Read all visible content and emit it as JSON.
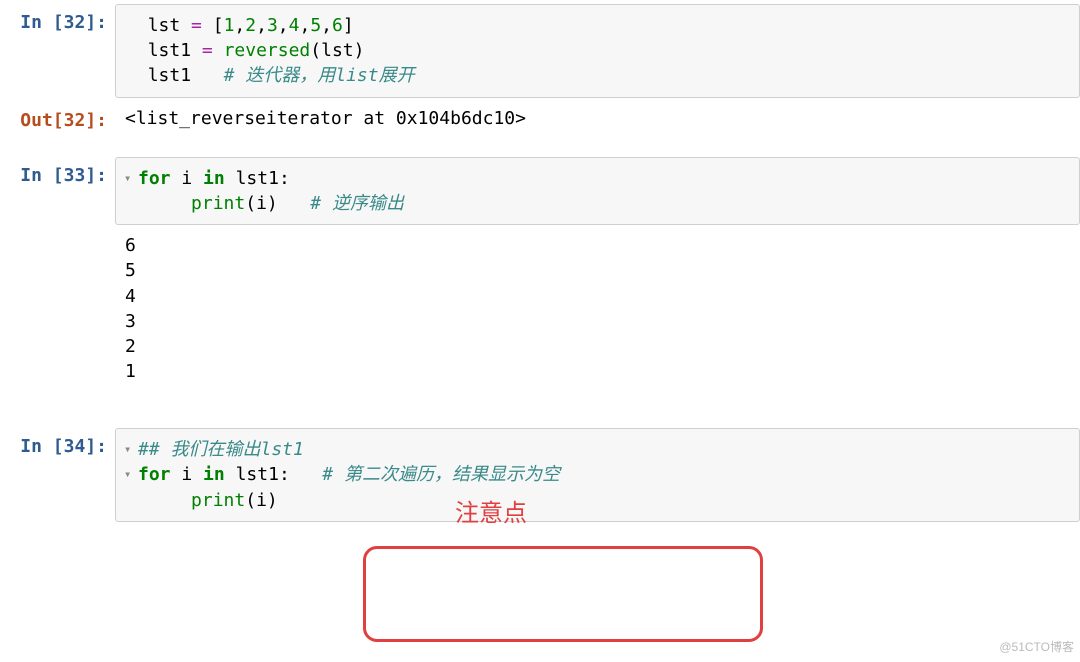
{
  "prompts": {
    "in32": "In [32]:",
    "out32": "Out[32]:",
    "in33": "In [33]:",
    "in34": "In [34]:"
  },
  "cell32": {
    "line1_var": "lst",
    "line1_eq": " = ",
    "line1_lb": "[",
    "line1_n1": "1",
    "line1_c1": ",",
    "line1_n2": "2",
    "line1_c2": ",",
    "line1_n3": "3",
    "line1_c3": ",",
    "line1_n4": "4",
    "line1_c4": ",",
    "line1_n5": "5",
    "line1_c5": ",",
    "line1_n6": "6",
    "line1_rb": "]",
    "blank": "",
    "line3_var": "lst1",
    "line3_eq": " = ",
    "line3_fn": "reversed",
    "line3_lp": "(",
    "line3_arg": "lst",
    "line3_rp": ")",
    "line4_var": "lst1",
    "line4_sp": "   ",
    "line4_cmt": "# 迭代器，用list展开"
  },
  "out32": {
    "text": "<list_reverseiterator at 0x104b6dc10>"
  },
  "cell33": {
    "expand1": "▾",
    "kw_for": "for",
    "sp1": " ",
    "var_i": "i",
    "sp2": " ",
    "kw_in": "in",
    "sp3": " ",
    "var_lst1": "lst1",
    "colon": ":",
    "indent2": "    ",
    "fn_print": "print",
    "lp": "(",
    "arg_i": "i",
    "rp": ")",
    "sp4": "   ",
    "cmt": "# 逆序输出"
  },
  "out33": {
    "l1": "6",
    "l2": "5",
    "l3": "4",
    "l4": "3",
    "l5": "2",
    "l6": "1"
  },
  "cell34": {
    "expand1": "▾",
    "cmt1": "## 我们在输出lst1",
    "blank": "",
    "expand2": "▾",
    "kw_for": "for",
    "sp1": " ",
    "var_i": "i",
    "sp2": " ",
    "kw_in": "in",
    "sp3": " ",
    "var_lst1": "lst1",
    "colon": ":",
    "sp4": "   ",
    "cmt2": "# 第二次遍历，结果显示为空",
    "indent2": "    ",
    "fn_print": "print",
    "lp": "(",
    "arg_i": "i",
    "rp": ")"
  },
  "annotation": {
    "label": "注意点"
  },
  "watermark": "@51CTO博客"
}
